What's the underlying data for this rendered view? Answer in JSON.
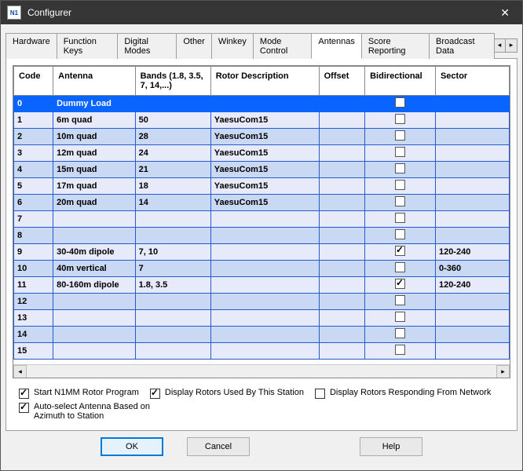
{
  "window": {
    "title": "Configurer"
  },
  "tabs": [
    "Hardware",
    "Function Keys",
    "Digital Modes",
    "Other",
    "Winkey",
    "Mode Control",
    "Antennas",
    "Score Reporting",
    "Broadcast Data"
  ],
  "active_tab": 6,
  "columns": [
    "Code",
    "Antenna",
    "Bands (1.8, 3.5, 7, 14,...)",
    "Rotor Description",
    "Offset",
    "Bidirectional",
    "Sector"
  ],
  "rows": [
    {
      "code": "0",
      "antenna": "Dummy Load",
      "bands": "",
      "rotor": "",
      "offset": "",
      "bidi": false,
      "sector": "",
      "sel": true
    },
    {
      "code": "1",
      "antenna": "6m quad",
      "bands": "50",
      "rotor": "YaesuCom15",
      "offset": "",
      "bidi": false,
      "sector": ""
    },
    {
      "code": "2",
      "antenna": "10m quad",
      "bands": "28",
      "rotor": "YaesuCom15",
      "offset": "",
      "bidi": false,
      "sector": ""
    },
    {
      "code": "3",
      "antenna": "12m quad",
      "bands": "24",
      "rotor": "YaesuCom15",
      "offset": "",
      "bidi": false,
      "sector": ""
    },
    {
      "code": "4",
      "antenna": "15m quad",
      "bands": "21",
      "rotor": "YaesuCom15",
      "offset": "",
      "bidi": false,
      "sector": ""
    },
    {
      "code": "5",
      "antenna": "17m quad",
      "bands": "18",
      "rotor": "YaesuCom15",
      "offset": "",
      "bidi": false,
      "sector": ""
    },
    {
      "code": "6",
      "antenna": "20m quad",
      "bands": "14",
      "rotor": "YaesuCom15",
      "offset": "",
      "bidi": false,
      "sector": ""
    },
    {
      "code": "7",
      "antenna": "",
      "bands": "",
      "rotor": "",
      "offset": "",
      "bidi": false,
      "sector": ""
    },
    {
      "code": "8",
      "antenna": "",
      "bands": "",
      "rotor": "",
      "offset": "",
      "bidi": false,
      "sector": ""
    },
    {
      "code": "9",
      "antenna": "30-40m dipole",
      "bands": "7, 10",
      "rotor": "",
      "offset": "",
      "bidi": true,
      "sector": "120-240"
    },
    {
      "code": "10",
      "antenna": "40m vertical",
      "bands": "7",
      "rotor": "",
      "offset": "",
      "bidi": false,
      "sector": "0-360"
    },
    {
      "code": "11",
      "antenna": "80-160m dipole",
      "bands": "1.8, 3.5",
      "rotor": "",
      "offset": "",
      "bidi": true,
      "sector": "120-240"
    },
    {
      "code": "12",
      "antenna": "",
      "bands": "",
      "rotor": "",
      "offset": "",
      "bidi": false,
      "sector": ""
    },
    {
      "code": "13",
      "antenna": "",
      "bands": "",
      "rotor": "",
      "offset": "",
      "bidi": false,
      "sector": ""
    },
    {
      "code": "14",
      "antenna": "",
      "bands": "",
      "rotor": "",
      "offset": "",
      "bidi": false,
      "sector": ""
    },
    {
      "code": "15",
      "antenna": "",
      "bands": "",
      "rotor": "",
      "offset": "",
      "bidi": false,
      "sector": ""
    }
  ],
  "options": {
    "start_rotor": {
      "label": "Start N1MM Rotor Program",
      "checked": true
    },
    "display_used": {
      "label": "Display Rotors Used By This Station",
      "checked": true
    },
    "display_network": {
      "label": "Display Rotors Responding From Network",
      "checked": false
    },
    "auto_select": {
      "label": "Auto-select Antenna Based on Azimuth to Station",
      "checked": true
    }
  },
  "buttons": {
    "ok": "OK",
    "cancel": "Cancel",
    "help": "Help"
  }
}
